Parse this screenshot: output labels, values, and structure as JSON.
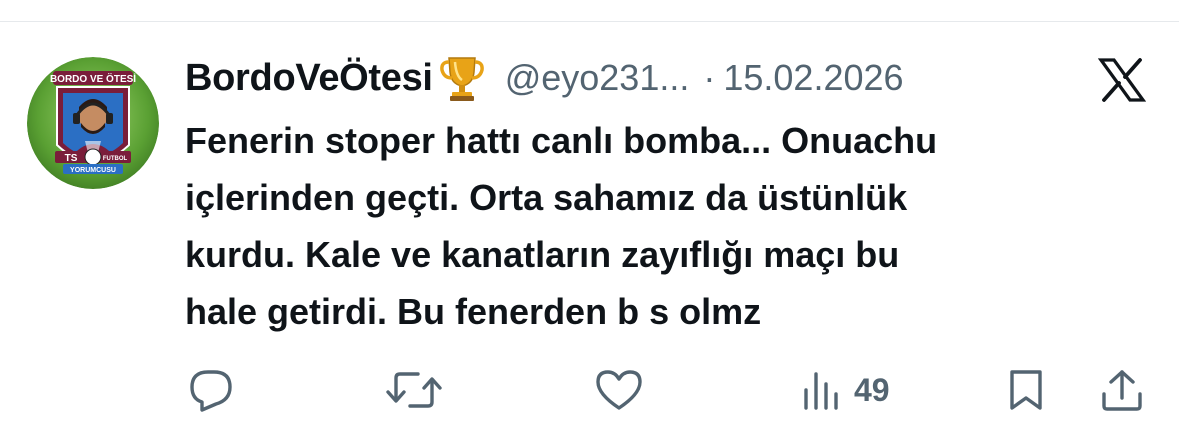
{
  "tweet": {
    "display_name": "BordoVeÖtesi",
    "handle": "@eyo231...",
    "separator": "·",
    "date": "15.02.2026",
    "text": "Fenerin stoper hattı canlı bomba... Onuachu\niçlerinden geçti. Orta sahamız da üstünlük\nkurdu. Kale ve kanatların zayıflığı maçı bu\nhale getirdi. Bu fenerden b s olmz",
    "name_emoji": "trophy-icon"
  },
  "avatar": {
    "badge_top": "BORDO VE ÖTESİ",
    "badge_left": "TS",
    "badge_right": "FUTBOL",
    "badge_bottom": "YORUMCUSU"
  },
  "actions": {
    "reply_icon": "reply-icon",
    "retweet_icon": "retweet-icon",
    "like_icon": "heart-icon",
    "views_icon": "views-icon",
    "views_count": "49",
    "bookmark_icon": "bookmark-icon",
    "share_icon": "share-icon"
  },
  "colors": {
    "text_primary": "#0f1419",
    "text_secondary": "#536471",
    "divider": "#e6e9ec",
    "avatar_ring": "#4a8a2a",
    "trophy_gold": "#e8a317",
    "maroon": "#7a1d3a",
    "blue": "#2b6fc4"
  }
}
